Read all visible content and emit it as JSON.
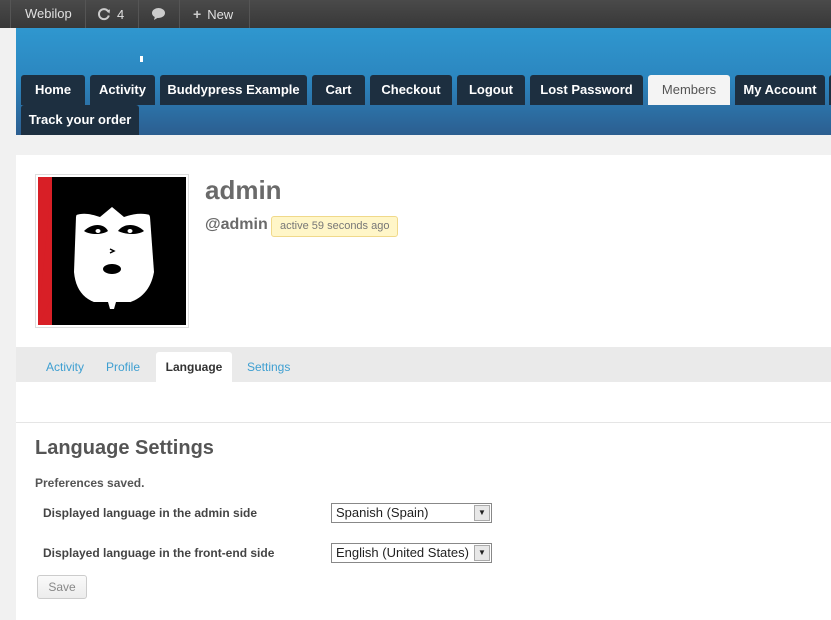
{
  "adminbar": {
    "site_name": "Webilop",
    "updates_count": "4",
    "new_label": "New",
    "icons": {
      "updates": "refresh-icon",
      "comments": "comment-icon",
      "new": "plus-icon"
    }
  },
  "nav": {
    "items": [
      {
        "label": "Home"
      },
      {
        "label": "Activity"
      },
      {
        "label": "Buddypress Example"
      },
      {
        "label": "Cart"
      },
      {
        "label": "Checkout"
      },
      {
        "label": "Logout"
      },
      {
        "label": "Lost Password"
      },
      {
        "label": "Members",
        "active": true
      },
      {
        "label": "My Account"
      },
      {
        "label": "Track your order"
      }
    ]
  },
  "member": {
    "name": "admin",
    "handle": "@admin",
    "activity": "active 59 seconds ago"
  },
  "tabs": [
    {
      "label": "Activity"
    },
    {
      "label": "Profile"
    },
    {
      "label": "Language",
      "active": true
    },
    {
      "label": "Settings"
    }
  ],
  "settings": {
    "title": "Language Settings",
    "message": "Preferences saved.",
    "admin_label": "Displayed language in the admin side",
    "admin_value": "Spanish (Spain)",
    "front_label": "Displayed language in the front-end side",
    "front_value": "English (United States)",
    "save_label": "Save"
  },
  "colors": {
    "header_top": "#2f97cf",
    "nav_bg": "#1d2f40",
    "link": "#3e9fd1",
    "badge_bg": "#fff6c8"
  }
}
